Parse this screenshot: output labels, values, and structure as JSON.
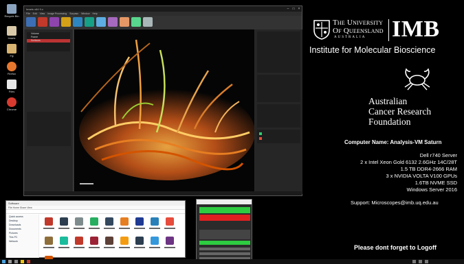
{
  "desktop": {
    "icons": [
      {
        "label": "Recycle Bin",
        "icon": "recycle-bin-icon",
        "color": "#8aa4c0"
      },
      {
        "label": "Imaris",
        "icon": "app-icon",
        "color": "#d9c9a8"
      },
      {
        "label": "Fiji",
        "icon": "app-icon",
        "color": "#d9b370"
      },
      {
        "label": "Firefox",
        "icon": "browser-icon",
        "color": "#e8772e"
      },
      {
        "label": "Files",
        "icon": "file-icon",
        "color": "#e8e8e8"
      },
      {
        "label": "Chrome",
        "icon": "browser-icon",
        "color": "#d83a2f"
      }
    ]
  },
  "imaris": {
    "title": "Imaris x64 9.x",
    "menu": [
      "File",
      "Edit",
      "View",
      "Image Processing",
      "Surpass",
      "Window",
      "Help"
    ],
    "tree_items": [
      "Volume",
      "Frame",
      "Surfaces"
    ],
    "accent": "#c0392b"
  },
  "explorer": {
    "title": "Software",
    "ribbon": "File  Home  Share  View",
    "nav_items": [
      "Quick access",
      "Desktop",
      "Downloads",
      "Documents",
      "Pictures",
      "This PC",
      "Network"
    ]
  },
  "info": {
    "uq_line1": "The University",
    "uq_line2": "Of Queensland",
    "uq_country": "AUSTRALIA",
    "imb": "IMB",
    "institute": "Institute for Molecular Bioscience",
    "acrf_line1": "Australian",
    "acrf_line2": "Cancer Research",
    "acrf_line3": "Foundation",
    "computer_name": "Computer Name: Analysis-VM Saturn",
    "specs": [
      "Dell r740 Server",
      "2 x Intel Xeon Gold 6132 2.6GHz 14C/28T",
      "1.5 TB DDR4-2666 RAM",
      "3 x NVIDIA VOLTA V100 GPUs",
      "1.6TB NVME SSD",
      "Windows Server 2016"
    ],
    "support": "Support: Microscopes@imb.uq.edu.au",
    "logoff": "Please dont forget to Logoff"
  }
}
